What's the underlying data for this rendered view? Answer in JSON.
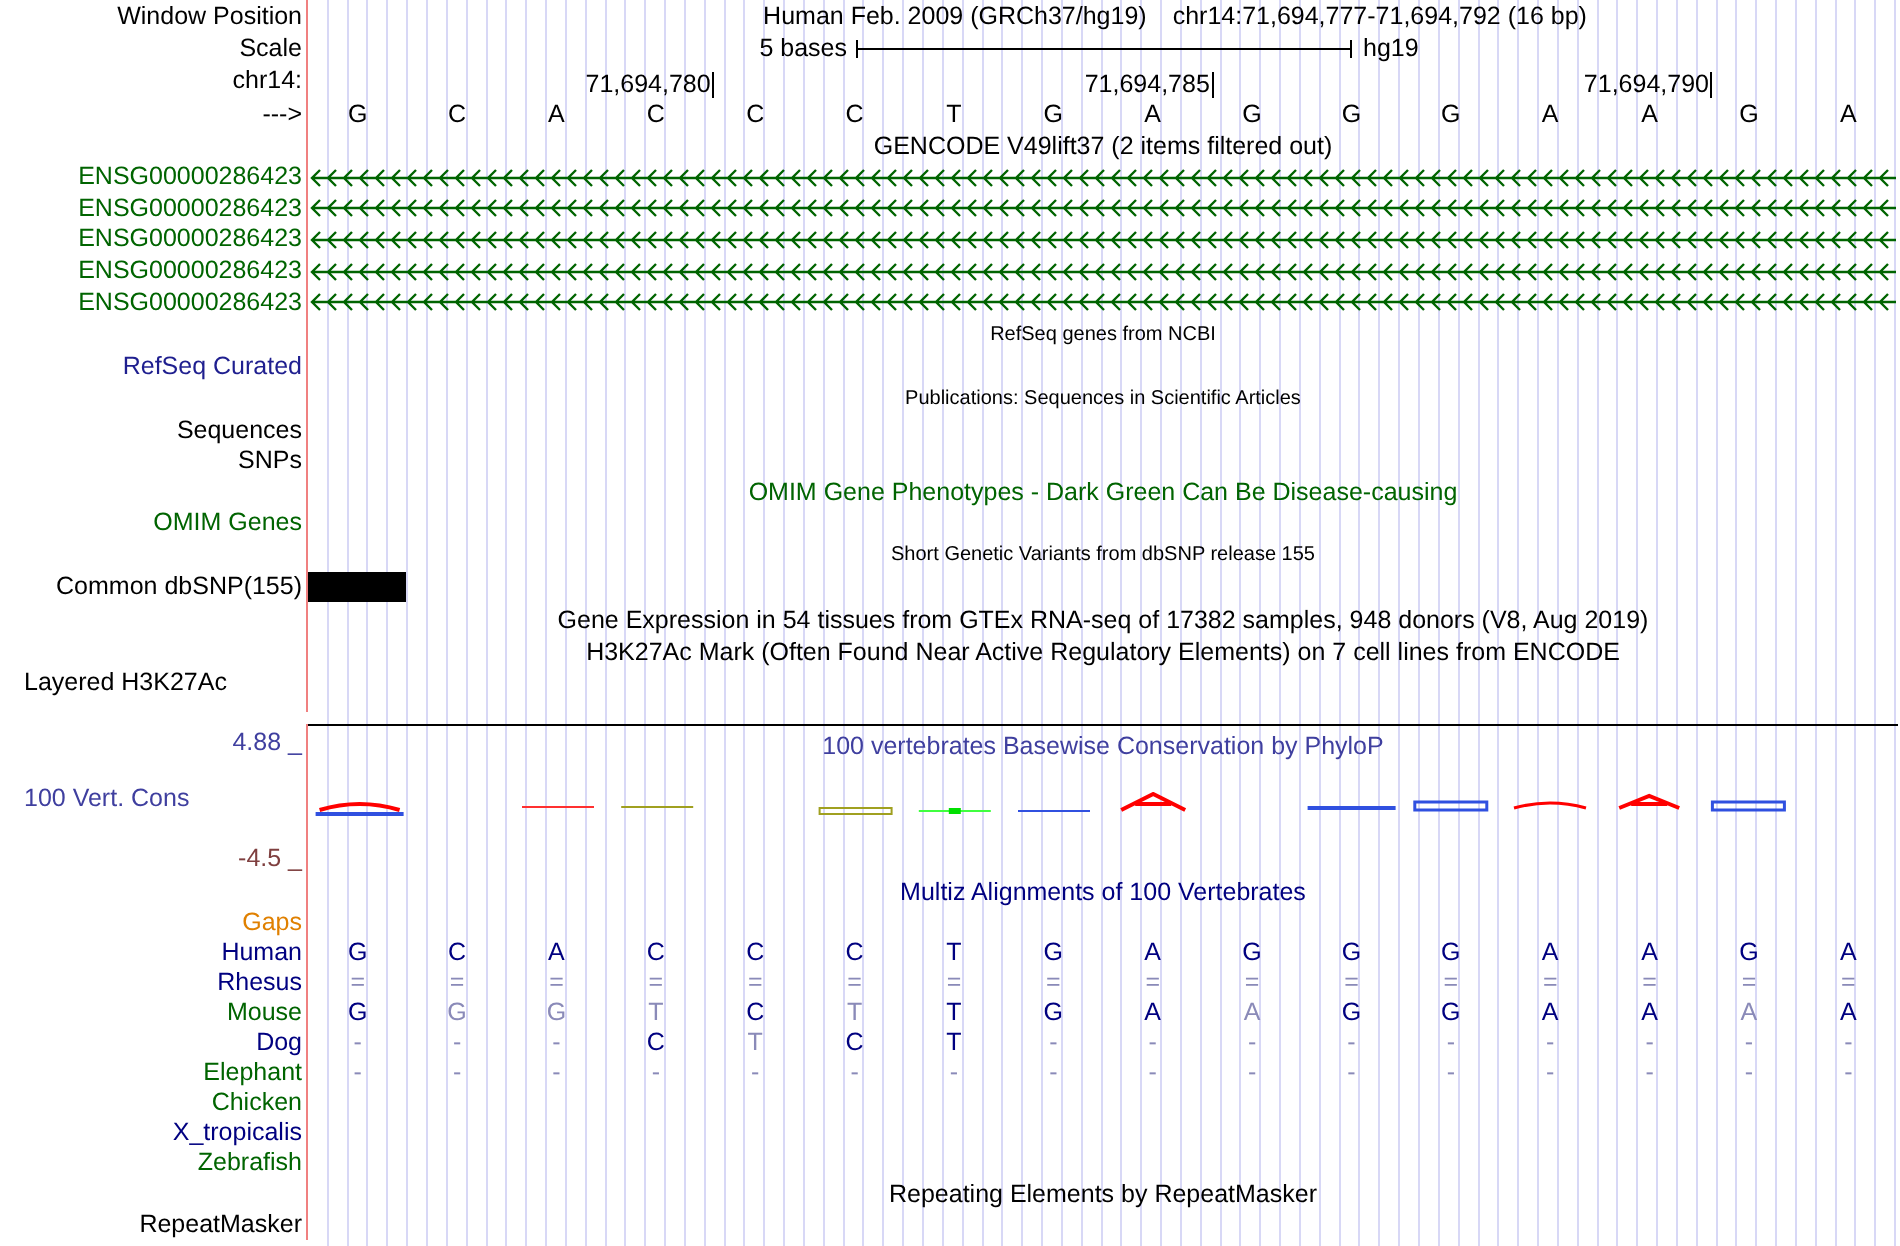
{
  "header": {
    "label": "Window Position",
    "assembly": "Human Feb. 2009 (GRCh37/hg19)",
    "position": "chr14:71,694,777-71,694,792 (16 bp)"
  },
  "scale": {
    "label": "Scale",
    "bar_label": "5 bases",
    "assembly": "hg19"
  },
  "ruler": {
    "label": "chr14:",
    "ticks": [
      "71,694,780",
      "71,694,785",
      "71,694,790"
    ]
  },
  "sequence": {
    "label": "--->",
    "bases": [
      "G",
      "C",
      "A",
      "C",
      "C",
      "C",
      "T",
      "G",
      "A",
      "G",
      "G",
      "G",
      "A",
      "A",
      "G",
      "A"
    ]
  },
  "tracks": [
    {
      "kind": "title",
      "text": "GENCODE V49lift37 (2 items filtered out)",
      "color": "#000000"
    },
    {
      "kind": "gene",
      "label": "ENSG00000286423",
      "color": "#006400"
    },
    {
      "kind": "gene",
      "label": "ENSG00000286423",
      "color": "#006400"
    },
    {
      "kind": "gene",
      "label": "ENSG00000286423",
      "color": "#006400"
    },
    {
      "kind": "gene",
      "label": "ENSG00000286423",
      "color": "#006400"
    },
    {
      "kind": "gene",
      "label": "ENSG00000286423",
      "color": "#006400"
    },
    {
      "kind": "caption",
      "text": "RefSeq genes from NCBI"
    },
    {
      "kind": "label",
      "label": "RefSeq Curated",
      "color": "#1f1f8f"
    },
    {
      "kind": "caption",
      "text": "Publications: Sequences in Scientific Articles"
    },
    {
      "kind": "label",
      "label": "Sequences",
      "color": "#000000"
    },
    {
      "kind": "label",
      "label": "SNPs",
      "color": "#000000"
    },
    {
      "kind": "title",
      "text": "OMIM Gene Phenotypes - Dark Green Can Be Disease-causing",
      "color": "#006400"
    },
    {
      "kind": "label",
      "label": "OMIM Genes",
      "color": "#006400"
    },
    {
      "kind": "caption",
      "text": "Short Genetic Variants from dbSNP release 155"
    },
    {
      "kind": "snp",
      "label": "Common dbSNP(155)",
      "color": "#000000"
    },
    {
      "kind": "title",
      "text": "Gene Expression in 54 tissues from GTEx RNA-seq of 17382 samples, 948 donors (V8, Aug 2019)",
      "color": "#000000"
    },
    {
      "kind": "title",
      "text": "H3K27Ac Mark (Often Found Near Active Regulatory Elements) on 7 cell lines from ENCODE",
      "color": "#000000"
    },
    {
      "kind": "layered",
      "label": "Layered H3K27Ac",
      "color": "#000000"
    },
    {
      "kind": "wiggle",
      "title": "100 vertebrates Basewise Conservation by PhyloP",
      "label": "100 Vert. Cons",
      "max": "4.88 _",
      "min": "-4.5 _",
      "color": "#3f3f9f"
    },
    {
      "kind": "title",
      "text": "Multiz Alignments of 100 Vertebrates",
      "color": "#000080"
    },
    {
      "kind": "label",
      "label": "Gaps",
      "color": "#e08000"
    },
    {
      "kind": "species",
      "label": "Human",
      "color": "#000080",
      "bases": [
        {
          "text": "G",
          "faded": false
        },
        {
          "text": "C",
          "faded": false
        },
        {
          "text": "A",
          "faded": false
        },
        {
          "text": "C",
          "faded": false
        },
        {
          "text": "C",
          "faded": false
        },
        {
          "text": "C",
          "faded": false
        },
        {
          "text": "T",
          "faded": false
        },
        {
          "text": "G",
          "faded": false
        },
        {
          "text": "A",
          "faded": false
        },
        {
          "text": "G",
          "faded": false
        },
        {
          "text": "G",
          "faded": false
        },
        {
          "text": "G",
          "faded": false
        },
        {
          "text": "A",
          "faded": false
        },
        {
          "text": "A",
          "faded": false
        },
        {
          "text": "G",
          "faded": false
        },
        {
          "text": "A",
          "faded": false
        }
      ]
    },
    {
      "kind": "species",
      "label": "Rhesus",
      "color": "#000080",
      "bases": [
        {
          "text": "=",
          "faded": true
        },
        {
          "text": "=",
          "faded": true
        },
        {
          "text": "=",
          "faded": true
        },
        {
          "text": "=",
          "faded": true
        },
        {
          "text": "=",
          "faded": true
        },
        {
          "text": "=",
          "faded": true
        },
        {
          "text": "=",
          "faded": true
        },
        {
          "text": "=",
          "faded": true
        },
        {
          "text": "=",
          "faded": true
        },
        {
          "text": "=",
          "faded": true
        },
        {
          "text": "=",
          "faded": true
        },
        {
          "text": "=",
          "faded": true
        },
        {
          "text": "=",
          "faded": true
        },
        {
          "text": "=",
          "faded": true
        },
        {
          "text": "=",
          "faded": true
        },
        {
          "text": "=",
          "faded": true
        }
      ]
    },
    {
      "kind": "species",
      "label": "Mouse",
      "color": "#006400",
      "bases": [
        {
          "text": "G",
          "faded": false
        },
        {
          "text": "G",
          "faded": true
        },
        {
          "text": "G",
          "faded": true
        },
        {
          "text": "T",
          "faded": true
        },
        {
          "text": "C",
          "faded": false
        },
        {
          "text": "T",
          "faded": true
        },
        {
          "text": "T",
          "faded": false
        },
        {
          "text": "G",
          "faded": false
        },
        {
          "text": "A",
          "faded": false
        },
        {
          "text": "A",
          "faded": true
        },
        {
          "text": "G",
          "faded": false
        },
        {
          "text": "G",
          "faded": false
        },
        {
          "text": "A",
          "faded": false
        },
        {
          "text": "A",
          "faded": false
        },
        {
          "text": "A",
          "faded": true
        },
        {
          "text": "A",
          "faded": false
        }
      ]
    },
    {
      "kind": "species",
      "label": "Dog",
      "color": "#000080",
      "bases": [
        {
          "text": "-",
          "faded": true
        },
        {
          "text": "-",
          "faded": true
        },
        {
          "text": "-",
          "faded": true
        },
        {
          "text": "C",
          "faded": false
        },
        {
          "text": "T",
          "faded": true
        },
        {
          "text": "C",
          "faded": false
        },
        {
          "text": "T",
          "faded": false
        },
        {
          "text": "-",
          "faded": true
        },
        {
          "text": "-",
          "faded": true
        },
        {
          "text": "-",
          "faded": true
        },
        {
          "text": "-",
          "faded": true
        },
        {
          "text": "-",
          "faded": true
        },
        {
          "text": "-",
          "faded": true
        },
        {
          "text": "-",
          "faded": true
        },
        {
          "text": "-",
          "faded": true
        },
        {
          "text": "-",
          "faded": true
        }
      ]
    },
    {
      "kind": "species",
      "label": "Elephant",
      "color": "#006400",
      "bases": [
        {
          "text": "-",
          "faded": true
        },
        {
          "text": "-",
          "faded": true
        },
        {
          "text": "-",
          "faded": true
        },
        {
          "text": "-",
          "faded": true
        },
        {
          "text": "-",
          "faded": true
        },
        {
          "text": "-",
          "faded": true
        },
        {
          "text": "-",
          "faded": true
        },
        {
          "text": "-",
          "faded": true
        },
        {
          "text": "-",
          "faded": true
        },
        {
          "text": "-",
          "faded": true
        },
        {
          "text": "-",
          "faded": true
        },
        {
          "text": "-",
          "faded": true
        },
        {
          "text": "-",
          "faded": true
        },
        {
          "text": "-",
          "faded": true
        },
        {
          "text": "-",
          "faded": true
        },
        {
          "text": "-",
          "faded": true
        }
      ]
    },
    {
      "kind": "label",
      "label": "Chicken",
      "color": "#006400"
    },
    {
      "kind": "label",
      "label": "X_tropicalis",
      "color": "#000080"
    },
    {
      "kind": "label",
      "label": "Zebrafish",
      "color": "#006400"
    },
    {
      "kind": "title",
      "text": "Repeating Elements by RepeatMasker",
      "color": "#000000"
    },
    {
      "kind": "label",
      "label": "RepeatMasker",
      "color": "#000000"
    }
  ]
}
